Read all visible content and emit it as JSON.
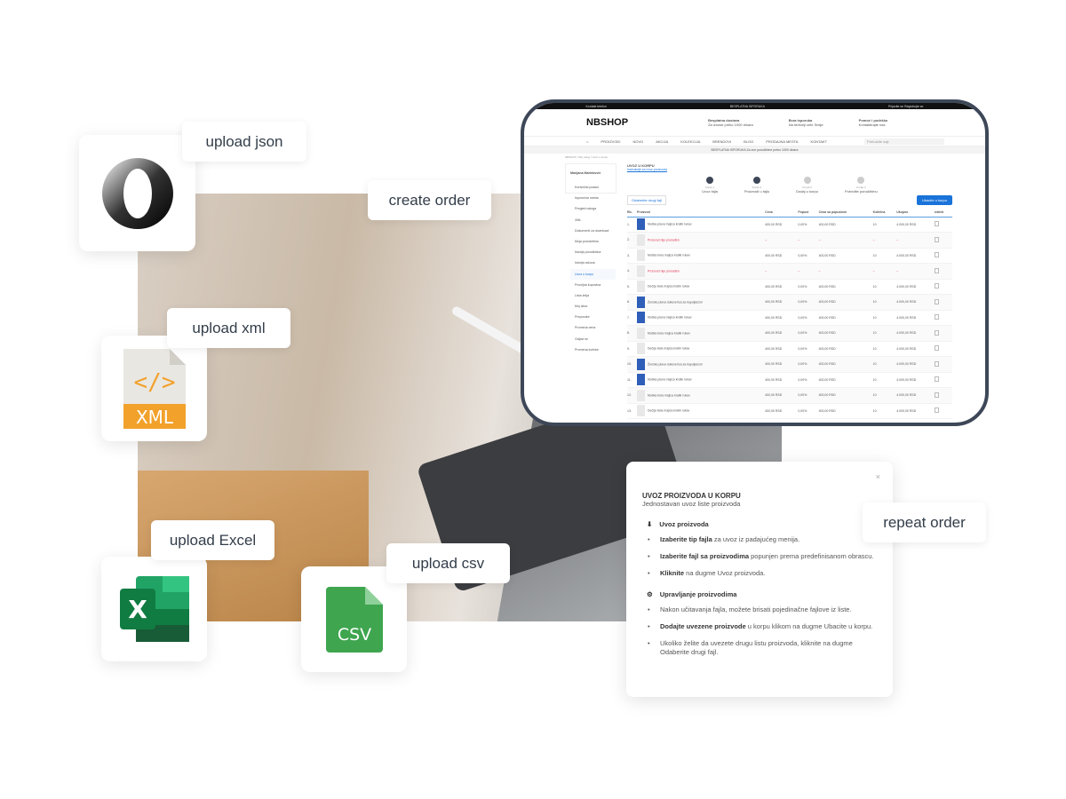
{
  "labels": {
    "upload_json": "upload json",
    "create_order": "create order",
    "upload_xml": "upload xml",
    "upload_excel": "upload Excel",
    "upload_csv": "upload csv",
    "repeat_order": "repeat order"
  },
  "icons": {
    "xml": "XML",
    "excel": "X",
    "csv": "CSV",
    "colors": {
      "xml": "#f2a12b",
      "excel": "#1e7145",
      "csv": "#3fa54f",
      "frame": "#3d4758",
      "accent": "#1a73d9"
    }
  },
  "shop": {
    "topbar": [
      "Kontakt telefon",
      "BESPLATNA ISPORUKA",
      "Prijavite se",
      "Registrujte se"
    ],
    "logo": "NBSHOP",
    "features": [
      {
        "t": "Besplatna dostava",
        "s": "Za iznose preko 1000 dinara"
      },
      {
        "t": "Brza isporuka",
        "s": "Na teritoriji cele Srbije"
      },
      {
        "t": "Pomoć i podrška",
        "s": "Kontaktirajte nas"
      }
    ],
    "nav": [
      "PROIZVODI",
      "NOVO",
      "AKCIJA",
      "KOLEKCIJA",
      "BRENDOVI",
      "BLOG",
      "PRODAJNA MESTA",
      "KONTAKT"
    ],
    "search_placeholder": "Pretražite sajt",
    "promo": "BESPLATNA ISPORUKA Za sve porudžbine preko 1000 dinara",
    "breadcrumb": "NBSHOP / Moj nalog / Uvoz u korpu",
    "user": "Marijana Marinković",
    "sidebar": [
      "Korisnički podaci",
      "Isporučna mesta",
      "Pregled naloga",
      "XML",
      "Dokumenti za download",
      "Moja porudžbina",
      "Istorija porudžbina",
      "Istorija računa",
      "Uvoz u korpu",
      "Povoljna kupovina",
      "Lista želja",
      "Moj izbor",
      "Preporuke",
      "Promena cena",
      "Odjavi se",
      "Promena lozinke"
    ],
    "page_title": "UVOZ U KORPU",
    "instructions_link": "Instrukcije za uvoz proizvoda",
    "steps": [
      {
        "n": "Korak 1",
        "l": "Uvoz fajla"
      },
      {
        "n": "Korak 2",
        "l": "Proizvodi u fajlu"
      },
      {
        "n": "Korak 3",
        "l": "Dodaj u korpu"
      },
      {
        "n": "Korak 4",
        "l": "Potvrdite porudžbinu"
      }
    ],
    "choose_file": "Odaberite drugi fajl",
    "add_to_cart": "Ubacite u korpu",
    "columns": [
      "Rb.",
      "Proizvod",
      "Cena",
      "Popust",
      "Cena sa popustom",
      "Količina",
      "Ukupno",
      "Izbriši"
    ],
    "rows": [
      [
        "1.",
        "Muška plava majica kratki rukav",
        "400,00 RSD",
        "0,00%",
        "400,00 RSD",
        "10",
        "4.000,00 RSD"
      ],
      [
        "2.",
        "Proizvod nije pronađen",
        "–",
        "–",
        "–",
        "–",
        "–"
      ],
      [
        "3.",
        "Muška bela majica kratki rukav",
        "400,00 RSD",
        "0,00%",
        "400,00 RSD",
        "10",
        "4.000,00 RSD"
      ],
      [
        "4.",
        "Proizvod nije pronađen",
        "–",
        "–",
        "–",
        "–",
        "–"
      ],
      [
        "5.",
        "Dečija bela majica kratki rukav",
        "400,00 RSD",
        "0,00%",
        "400,00 RSD",
        "10",
        "4.000,00 RSD"
      ],
      [
        "6.",
        "Ženska plava duksverica sa kapuljačom",
        "400,00 RSD",
        "0,00%",
        "400,00 RSD",
        "10",
        "4.000,00 RSD"
      ],
      [
        "7.",
        "Muška plava majica kratki rukav",
        "400,00 RSD",
        "0,00%",
        "400,00 RSD",
        "10",
        "4.000,00 RSD"
      ],
      [
        "8.",
        "Muška bela majica kratki rukav",
        "400,00 RSD",
        "0,00%",
        "400,00 RSD",
        "10",
        "4.000,00 RSD"
      ],
      [
        "9.",
        "Dečija bela majica kratki rukav",
        "400,00 RSD",
        "0,00%",
        "400,00 RSD",
        "10",
        "4.000,00 RSD"
      ],
      [
        "10.",
        "Ženska plava duksverica sa kapuljačom",
        "400,00 RSD",
        "0,00%",
        "400,00 RSD",
        "10",
        "4.000,00 RSD"
      ],
      [
        "11.",
        "Muška plava majica kratki rukav",
        "400,00 RSD",
        "0,00%",
        "400,00 RSD",
        "10",
        "4.000,00 RSD"
      ],
      [
        "12.",
        "Muška bela majica kratki rukav",
        "400,00 RSD",
        "0,00%",
        "400,00 RSD",
        "10",
        "4.000,00 RSD"
      ],
      [
        "13.",
        "Dečija bela majica kratki rukav",
        "400,00 RSD",
        "0,00%",
        "400,00 RSD",
        "10",
        "4.000,00 RSD"
      ]
    ]
  },
  "popup": {
    "title": "UVOZ PROIZVODA U KORPU",
    "subtitle": "Jednostavan uvoz liste proizvoda",
    "s1": "Uvoz proizvoda",
    "s1_items": [
      [
        "Izaberite tip fajla",
        " za uvoz iz padajućeg menija."
      ],
      [
        "Izaberite fajl sa proizvodima",
        " popunjen prema predefinisanom obrascu."
      ],
      [
        "Kliknite",
        " na dugme Uvoz proizvoda."
      ]
    ],
    "s2": "Upravljanje proizvodima",
    "s2_items": [
      [
        "",
        "Nakon učitavanja fajla, možete brisati pojedinačne fajlove iz liste."
      ],
      [
        "Dodajte uvezene proizvode",
        " u korpu klikom na dugme Ubacite u korpu."
      ],
      [
        "",
        "Ukoliko želite da uvezete drugu listu proizvoda, kliknite na dugme Odaberite drugi fajl."
      ]
    ]
  }
}
